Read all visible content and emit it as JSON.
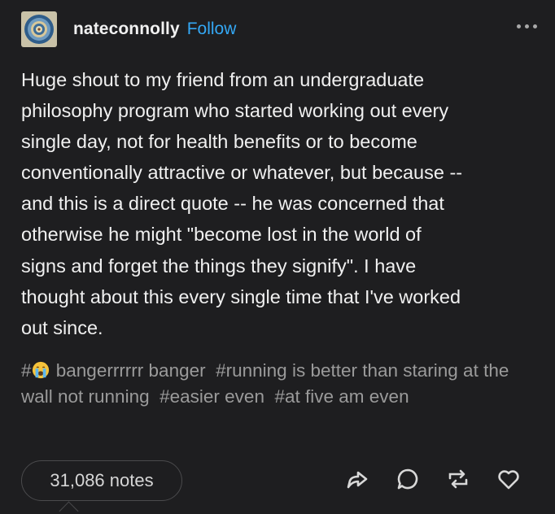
{
  "post": {
    "username": "nateconnolly",
    "follow_label": "Follow",
    "avatar_icon": "mandala-avatar",
    "more_icon": "ellipsis-icon",
    "body": "Huge shout to my friend from an undergraduate\nphilosophy program who started working out every\nsingle day, not for health benefits or to become\nconventionally attractive or whatever, but because --\nand this is a direct quote -- he was concerned that\notherwise he might \"become lost in the world of\nsigns and forget the things they signify\". I have\nthought about this every single time that I've worked\nout since."
  },
  "tags": [
    {
      "prefix": "#",
      "emoji": "crying-face",
      "text": " bangerrrrrr banger"
    },
    {
      "text": "#running is better than staring at the wall not running"
    },
    {
      "text": "#easier even"
    },
    {
      "text": "#at five am even"
    }
  ],
  "footer": {
    "notes": "31,086 notes",
    "actions": [
      "share-icon",
      "reply-icon",
      "reblog-icon",
      "like-icon"
    ]
  },
  "colors": {
    "background": "#1e1e20",
    "text": "#f0f0f0",
    "tag": "#9a9a9a",
    "follow": "#34a8f5"
  }
}
